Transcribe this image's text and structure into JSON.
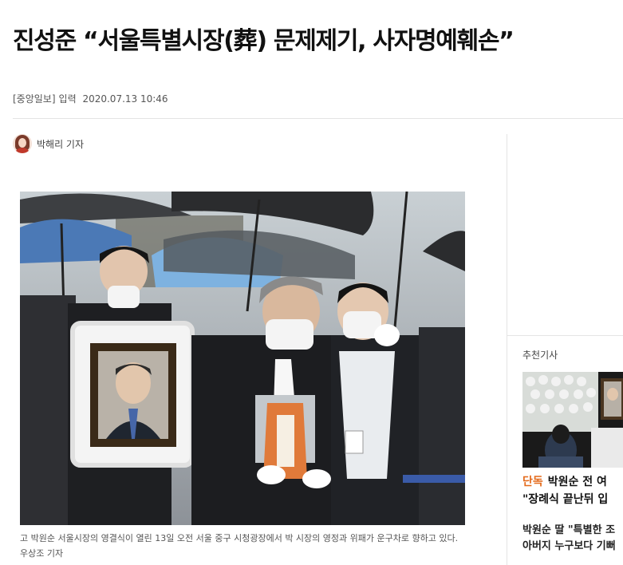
{
  "article": {
    "headline": "진성준 “서울특별시장(葬) 문제제기, 사자명예훼손”",
    "source": "[중앙일보]",
    "input_label": "입력",
    "datetime": "2020.07.13 10:46",
    "reporter": "박해리 기자",
    "photo_caption": "고 박원순 서울시장의 영결식이 열린 13일 오전 서울 중구 시청광장에서 박 시장의 영정과 위패가 운구차로 향하고 있다. 우상조 기자"
  },
  "sidebar": {
    "title": "추천기사",
    "items": [
      {
        "tag": "단독",
        "line1": "박원순 전 여",
        "line2": "\"장례식 끝난뒤 입"
      },
      {
        "line1": "박원순 딸 \"특별한 조",
        "line2": "아버지 누구보다 기뻐"
      }
    ]
  },
  "colors": {
    "accent": "#e46a1b",
    "text": "#222222",
    "divider": "#e4e4e4"
  }
}
